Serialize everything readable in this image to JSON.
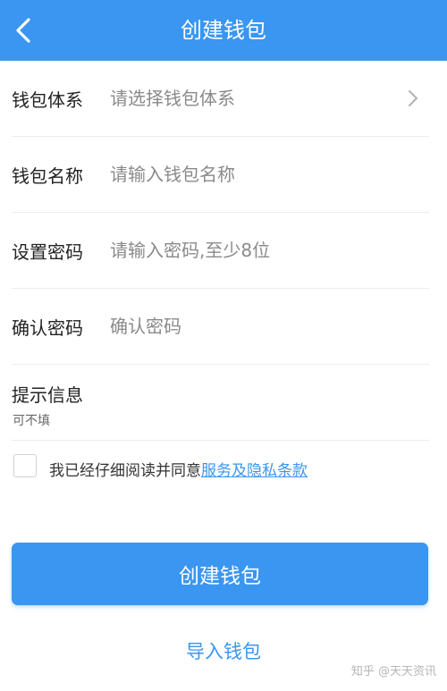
{
  "header": {
    "title": "创建钱包",
    "back_icon": "chevron-left-icon"
  },
  "form": {
    "wallet_system": {
      "label": "钱包体系",
      "placeholder": "请选择钱包体系",
      "icon": "chevron-right-icon"
    },
    "wallet_name": {
      "label": "钱包名称",
      "placeholder": "请输入钱包名称"
    },
    "password": {
      "label": "设置密码",
      "placeholder": "请输入密码,至少8位"
    },
    "confirm_password": {
      "label": "确认密码",
      "placeholder": "确认密码"
    },
    "hint": {
      "label": "提示信息",
      "sub": "可不填"
    }
  },
  "agreement": {
    "text": "我已经仔细阅读并同意",
    "link": "服务及隐私条款"
  },
  "actions": {
    "create_label": "创建钱包",
    "import_label": "导入钱包"
  },
  "watermark": "知乎 @天天资讯",
  "colors": {
    "accent": "#3a96f0",
    "text": "#222222",
    "placeholder": "#8a8a8a"
  }
}
